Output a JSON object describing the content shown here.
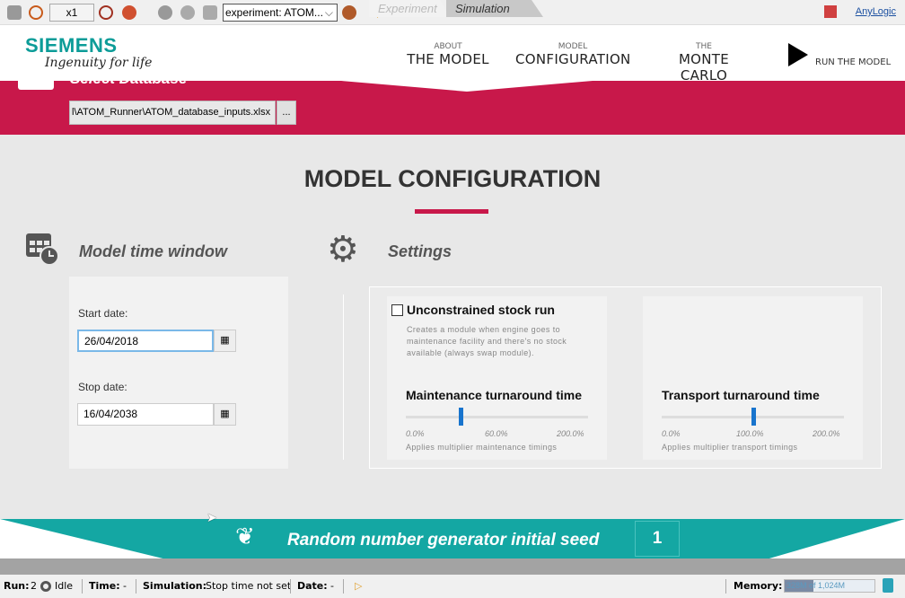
{
  "toolbar": {
    "speed": "x1",
    "experiment": "experiment: ATOM...",
    "experiment_chevron": "⌵",
    "anylogic": "AnyLogic"
  },
  "header": {
    "brand": "SIEMENS",
    "tagline": "Ingenuity for life",
    "nav": [
      {
        "small": "ABOUT",
        "big": "THE MODEL"
      },
      {
        "small": "MODEL",
        "big": "CONFIGURATION"
      },
      {
        "small": "THE",
        "big": "MONTE CARLO"
      }
    ],
    "run": "RUN THE MODEL"
  },
  "database": {
    "title": "Select Database",
    "path": "l\\ATOM_Runner\\ATOM_database_inputs.xlsx",
    "browse": "..."
  },
  "main": {
    "title": "MODEL CONFIGURATION"
  },
  "time_window": {
    "title": "Model time window",
    "start_label": "Start date:",
    "start_value": "26/04/2018",
    "stop_label": "Stop date:",
    "stop_value": "16/04/2038",
    "cal_icon": "▦"
  },
  "settings": {
    "title": "Settings",
    "tabs": [
      {
        "label": "Experiment",
        "active": false
      },
      {
        "label": "Simulation",
        "active": true
      }
    ],
    "unconstrained": {
      "label": "Unconstrained stock run",
      "checked": false,
      "desc": "Creates a module when engine goes to maintenance facility and there's no stock available (always swap module)."
    },
    "maintenance": {
      "title": "Maintenance turnaround time",
      "min": "0.0%",
      "value": "60.0%",
      "max": "200.0%",
      "value_num": 60,
      "range": [
        0,
        200
      ],
      "desc": "Applies multiplier maintenance timings"
    },
    "transport": {
      "title": "Transport turnaround time",
      "min": "0.0%",
      "value": "100.0%",
      "max": "200.0%",
      "value_num": 100,
      "range": [
        0,
        200
      ],
      "desc": "Applies multiplier transport timings"
    }
  },
  "seed": {
    "label": "Random number generator initial seed",
    "value": "1"
  },
  "status": {
    "run_label": "Run:",
    "run_value": "2",
    "state": "Idle",
    "time_label": "Time:",
    "time_value": "-",
    "sim_label": "Simulation:",
    "sim_value": "Stop time not set",
    "date_label": "Date:",
    "date_value": "-",
    "memory_label": "Memory:",
    "memory_value": "328M of 1,024M",
    "memory_fraction": 0.32
  },
  "colors": {
    "crimson": "#c8184a",
    "teal": "#14a7a3",
    "accent_blue": "#1874cd"
  }
}
